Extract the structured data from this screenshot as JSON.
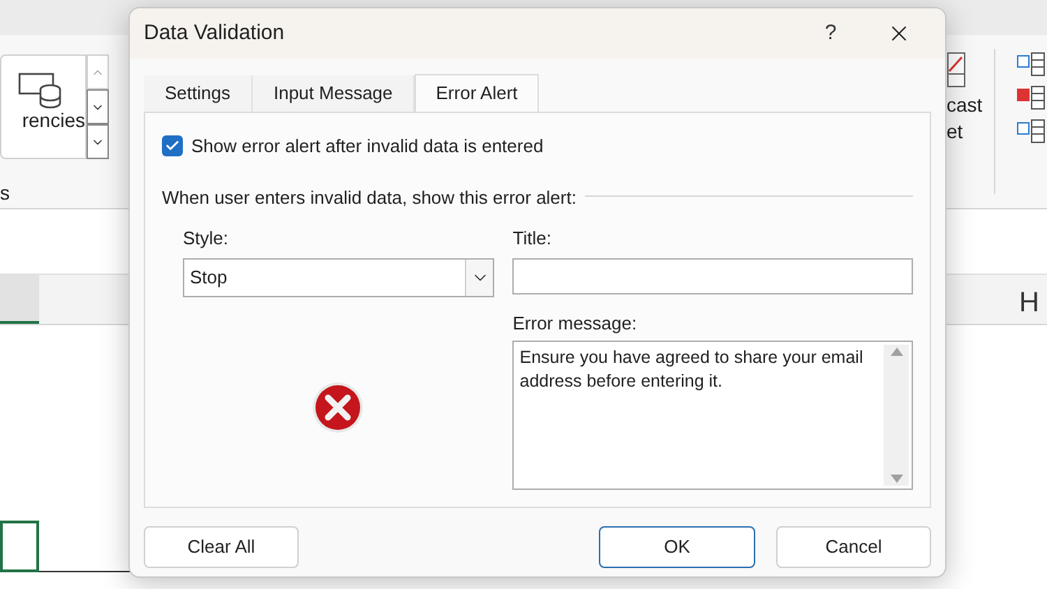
{
  "ribbon": {
    "group_label_fragment": "rencies",
    "section_label_fragment": "s",
    "right_labels": [
      "cast",
      "et"
    ]
  },
  "column_headers": [
    "H"
  ],
  "dialog": {
    "title": "Data Validation",
    "help": "?",
    "tabs": [
      {
        "label": "Settings",
        "selected": false
      },
      {
        "label": "Input Message",
        "selected": false
      },
      {
        "label": "Error Alert",
        "selected": true
      }
    ],
    "show_alert": {
      "label": "Show error alert after invalid data is entered",
      "checked": true
    },
    "group_label": "When user enters invalid data, show this error alert:",
    "style": {
      "label": "Style:",
      "value": "Stop"
    },
    "title_field": {
      "label": "Title:"
    },
    "error_message": {
      "label": "Error message:",
      "value": "Ensure you have agreed to share your email address before entering it."
    },
    "buttons": [
      {
        "label": "Clear All",
        "default": false
      },
      {
        "label": "OK",
        "default": true
      },
      {
        "label": "Cancel",
        "default": false
      }
    ]
  }
}
